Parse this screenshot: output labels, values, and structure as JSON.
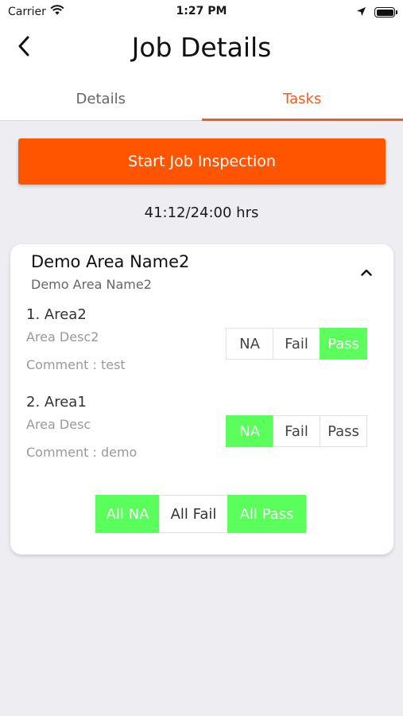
{
  "status_bar": {
    "carrier": "Carrier",
    "time": "1:27 PM"
  },
  "header": {
    "title": "Job Details"
  },
  "tabs": [
    {
      "label": "Details",
      "active": false
    },
    {
      "label": "Tasks",
      "active": true
    }
  ],
  "start_button": {
    "label": "Start Job Inspection"
  },
  "hours": "41:12/24:00 hrs",
  "area": {
    "title": "Demo Area Name2",
    "subtitle": "Demo Area Name2",
    "tasks": [
      {
        "title": "1. Area2",
        "description": "Area Desc2",
        "comment": "Comment : test",
        "options": [
          "NA",
          "Fail",
          "Pass"
        ],
        "selected": "Pass"
      },
      {
        "title": "2. Area1",
        "description": "Area Desc",
        "comment": "Comment : demo",
        "options": [
          "NA",
          "Fail",
          "Pass"
        ],
        "selected": "NA"
      }
    ],
    "bulk": {
      "all_na": "All NA",
      "all_fail": "All Fail",
      "all_pass": "All Pass"
    }
  },
  "colors": {
    "accent": "#FF5500",
    "tab_active": "#F5591B",
    "selected": "#5BFF5B",
    "background": "#EEEEF2"
  }
}
